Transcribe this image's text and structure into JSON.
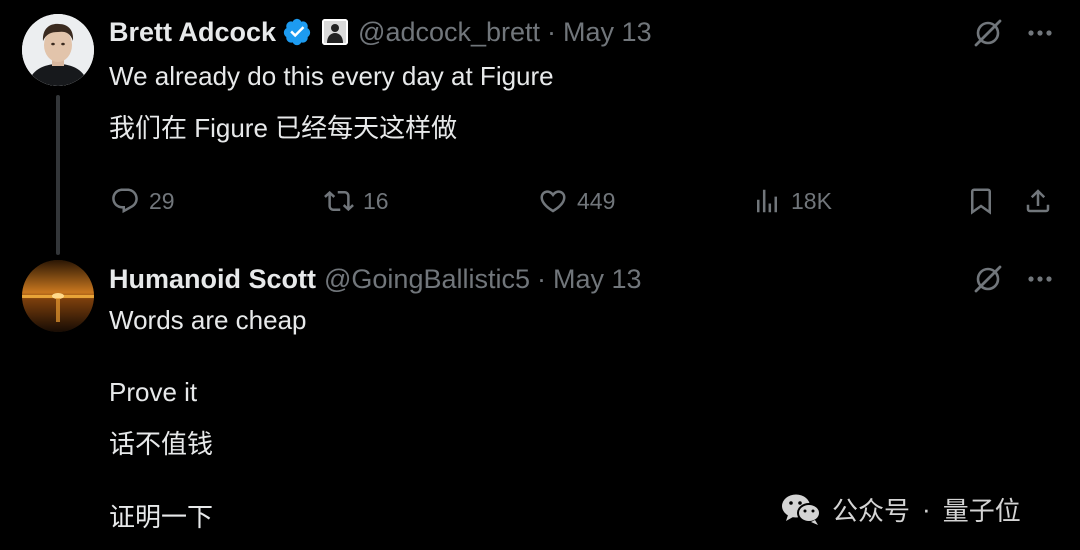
{
  "tweets": [
    {
      "display_name": "Brett Adcock",
      "handle": "@adcock_brett",
      "separator": "·",
      "date": "May 13",
      "lines": [
        "We already do this every day at Figure",
        "我们在 Figure 已经每天这样做"
      ],
      "actions": {
        "reply_count": "29",
        "retweet_count": "16",
        "like_count": "449",
        "views_count": "18K"
      }
    },
    {
      "display_name": "Humanoid Scott",
      "handle": "@GoingBallistic5",
      "separator": "·",
      "date": "May 13",
      "lines": [
        "Words are cheap",
        "Prove it",
        "话不值钱",
        "证明一下"
      ]
    }
  ],
  "watermark": {
    "label": "公众号",
    "separator": "·",
    "name": "量子位"
  },
  "colors": {
    "background": "#000000",
    "text_primary": "#e7e9ea",
    "text_secondary": "#71767b",
    "verified_blue": "#1d9bf0",
    "thread_line": "#333639"
  },
  "icons": [
    "verified-badge-icon",
    "affiliate-badge-icon",
    "grok-icon",
    "more-icon",
    "reply-icon",
    "retweet-icon",
    "like-icon",
    "views-icon",
    "bookmark-icon",
    "share-icon",
    "wechat-icon"
  ]
}
